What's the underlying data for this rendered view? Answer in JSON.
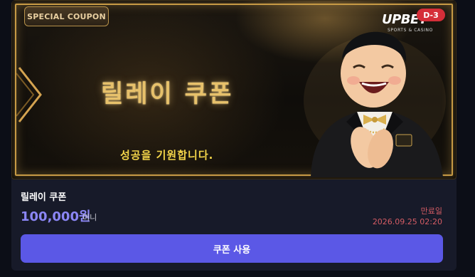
{
  "banner": {
    "badge": "SPECIAL COUPON",
    "brand_logo": "UPBET",
    "brand_sub": "SPORTS & CASINO",
    "dday": "D-3",
    "headline": "릴레이 쿠폰",
    "slogan": "성공을 기원합니다."
  },
  "coupon": {
    "name": "릴레이 쿠폰",
    "amount": "100,000원",
    "unit": "머니",
    "expiry_label": "만료일",
    "expiry_date": "2026.09.25 02:20",
    "use_button": "쿠폰 사용"
  },
  "colors": {
    "accent": "#5b58e6",
    "amount": "#8b86f5",
    "gold": "#c79a45",
    "expiry": "#d45c64",
    "badge_red": "#d52e38"
  }
}
